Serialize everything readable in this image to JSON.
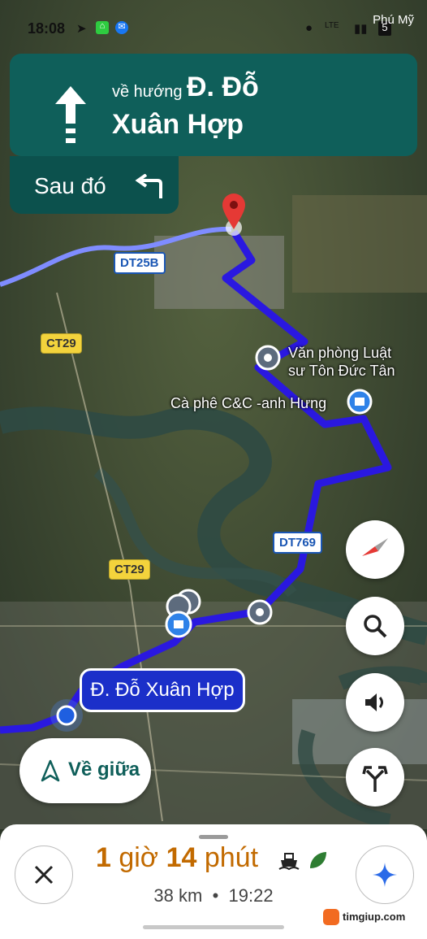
{
  "status_bar": {
    "time": "18:08",
    "carrier": "Phú Mỹ",
    "icons": [
      "navigation-arrow-icon",
      "app-icon",
      "messenger-icon",
      "location-icon",
      "lte-icon",
      "signal-icon",
      "battery-icon"
    ],
    "battery": "5"
  },
  "navigation": {
    "direction_icon": "straight-arrow-icon",
    "prefix": "về hướng",
    "road_line1": "Đ. Đỗ",
    "road_line2": "Xuân Hợp",
    "then_label": "Sau đó",
    "then_icon": "turn-left-icon"
  },
  "map": {
    "road_badges": [
      "DT25B",
      "CT29",
      "DT769",
      "CT29"
    ],
    "pois": [
      "Văn phòng Luật",
      "sư Tôn Đức Tân",
      "Cà phê C&C -anh Hưng"
    ],
    "destination_label": "Đ. Đỗ Xuân Hợp",
    "route_color": "#2a18e0"
  },
  "controls": {
    "compass": "compass-icon",
    "search": "search-icon",
    "sound": "volume-icon",
    "route_options": "fork-icon",
    "recenter_label": "Về giữa"
  },
  "eta": {
    "hours": "1",
    "hours_unit": "giờ",
    "minutes": "14",
    "minutes_unit": "phút",
    "distance": "38 km",
    "separator": "•",
    "arrival": "19:22",
    "accent": "#c26a00"
  },
  "watermark": {
    "text": "timgiup.com"
  }
}
